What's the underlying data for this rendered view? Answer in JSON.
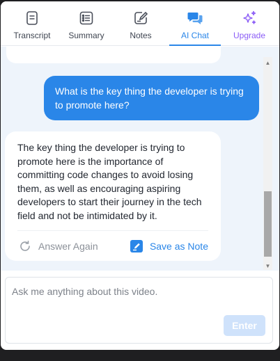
{
  "tabs": [
    {
      "label": "Transcript",
      "icon": "transcript-icon"
    },
    {
      "label": "Summary",
      "icon": "summary-icon"
    },
    {
      "label": "Notes",
      "icon": "notes-icon"
    },
    {
      "label": "AI Chat",
      "icon": "ai-chat-icon",
      "active": true
    },
    {
      "label": "Upgrade",
      "icon": "sparkle-icon"
    }
  ],
  "chat": {
    "user_message": "What is the key thing the developer is trying to promote here?",
    "ai_message": "The key thing the developer is trying to promote here is the importance of committing code changes to avoid losing them, as well as encouraging aspiring developers to start their journey in the tech field and not be intimidated by it.",
    "answer_again_label": "Answer Again",
    "save_note_label": "Save as Note"
  },
  "input": {
    "placeholder": "Ask me anything about this video.",
    "value": "",
    "enter_label": "Enter"
  },
  "colors": {
    "accent": "#2a86e8",
    "upgrade": "#8b5cf6",
    "chat_background": "#eef4fb",
    "enter_disabled": "#cfe2fb"
  }
}
